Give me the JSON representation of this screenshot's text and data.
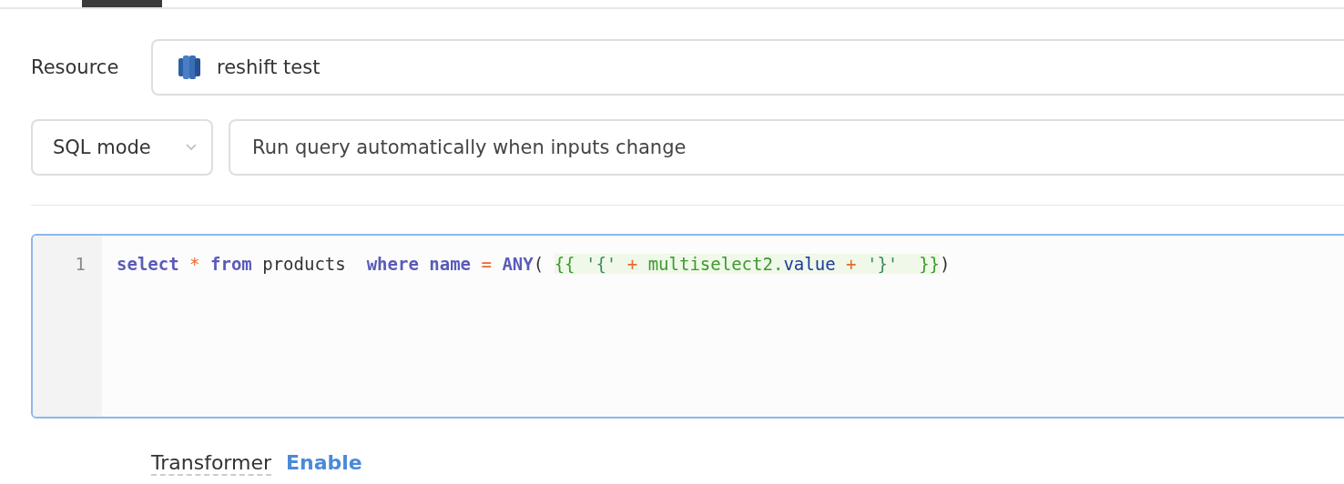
{
  "resource": {
    "label": "Resource",
    "value": "reshift test"
  },
  "mode_select": {
    "value": "SQL mode"
  },
  "run_mode_field": {
    "value": "Run query automatically when inputs change"
  },
  "editor": {
    "lines": [
      {
        "number": "1",
        "tokens": [
          {
            "kind": "keyword",
            "text": "select"
          },
          {
            "kind": "operator",
            "text": "*"
          },
          {
            "kind": "keyword",
            "text": "from"
          },
          {
            "kind": "plain",
            "text": "products "
          },
          {
            "kind": "keyword",
            "text": "where"
          },
          {
            "kind": "keyword",
            "text": "name"
          },
          {
            "kind": "operator",
            "text": "="
          },
          {
            "kind": "keyword",
            "text": "ANY"
          },
          {
            "kind": "punct",
            "text": "( "
          },
          {
            "kind": "template",
            "tokens": [
              {
                "kind": "brace",
                "text": "{{"
              },
              {
                "kind": "string",
                "text": "'{'"
              },
              {
                "kind": "operator",
                "text": "+"
              },
              {
                "kind": "variable",
                "text": "multiselect2."
              },
              {
                "kind": "property",
                "text": "value"
              },
              {
                "kind": "operator",
                "text": "+"
              },
              {
                "kind": "string",
                "text": "'}' "
              },
              {
                "kind": "brace",
                "text": "}}"
              }
            ]
          },
          {
            "kind": "punct",
            "text": ")"
          }
        ]
      }
    ]
  },
  "transformer": {
    "label": "Transformer",
    "link": "Enable"
  }
}
